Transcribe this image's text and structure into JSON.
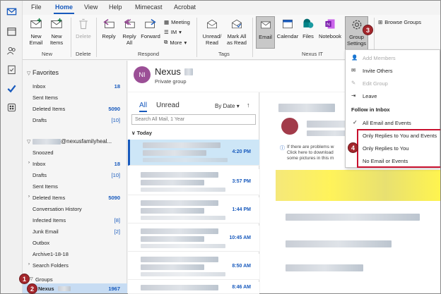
{
  "ribbon_tabs": [
    "File",
    "Home",
    "View",
    "Help",
    "Mimecast",
    "Acrobat"
  ],
  "ribbon": {
    "new_email": "New\nEmail",
    "new_items": "New\nItems",
    "delete": "Delete",
    "reply": "Reply",
    "reply_all": "Reply\nAll",
    "forward": "Forward",
    "meeting": "Meeting",
    "im": "IM",
    "more": "More",
    "unread_read": "Unread/\nRead",
    "mark_all_read": "Mark All\nas Read",
    "email": "Email",
    "calendar": "Calendar",
    "files": "Files",
    "notebook": "Notebook",
    "group_settings": "Group\nSettings",
    "browse_groups": "Browse Groups",
    "groups": {
      "new": "New",
      "delete": "Delete",
      "respond": "Respond",
      "tags": "Tags",
      "nexus_it": "Nexus IT"
    }
  },
  "badges": [
    "1",
    "2",
    "3",
    "4"
  ],
  "folders": {
    "favorites_title": "Favorites",
    "favorites": [
      {
        "label": "Inbox",
        "count": "18"
      },
      {
        "label": "Sent Items",
        "count": ""
      },
      {
        "label": "Deleted Items",
        "count": "5090"
      },
      {
        "label": "Drafts",
        "count": "[10]"
      }
    ],
    "account_title": "@nexusfamilyheal...",
    "account_items": [
      {
        "label": "Snoozed",
        "count": ""
      },
      {
        "label": "Inbox",
        "count": "18"
      },
      {
        "label": "Drafts",
        "count": "[10]"
      },
      {
        "label": "Sent Items",
        "count": ""
      },
      {
        "label": "Deleted Items",
        "count": "5090"
      },
      {
        "label": "Conversation History",
        "count": ""
      },
      {
        "label": "Infected Items",
        "count": "[8]"
      },
      {
        "label": "Junk Email",
        "count": "[2]"
      },
      {
        "label": "Outbox",
        "count": ""
      },
      {
        "label": "Archive1-18-18",
        "count": ""
      },
      {
        "label": "Search Folders",
        "count": ""
      }
    ],
    "groups_title": "Groups",
    "groups": [
      {
        "label": "Nexus",
        "count": "1967"
      }
    ]
  },
  "group_header": {
    "initials": "NI",
    "name": "Nexus",
    "subtitle": "Private group"
  },
  "list": {
    "tab_all": "All",
    "tab_unread": "Unread",
    "sort": "By Date",
    "search_placeholder": "Search All Mail, 1 Year",
    "today": "Today",
    "messages": [
      {
        "time": "4:20 PM"
      },
      {
        "time": "3:57 PM"
      },
      {
        "time": "1:44 PM"
      },
      {
        "time": "10:45 AM"
      },
      {
        "time": "8:50 AM"
      },
      {
        "time": "8:46 AM"
      }
    ]
  },
  "reading": {
    "info_line1": "If there are problems w",
    "info_line2": "Click here to download",
    "info_line3": "some pictures in this m"
  },
  "menu": {
    "add_members": "Add Members",
    "invite_others": "Invite Others",
    "edit_group": "Edit Group",
    "leave": "Leave",
    "follow_header": "Follow in Inbox",
    "all_email": "All Email and Events",
    "replies_events": "Only Replies to You and Events",
    "replies_only": "Only Replies to You",
    "no_email": "No Email or Events"
  },
  "colors": {
    "accent": "#185abd",
    "badge": "#a4262c",
    "highlight_box": "#c8102e"
  }
}
